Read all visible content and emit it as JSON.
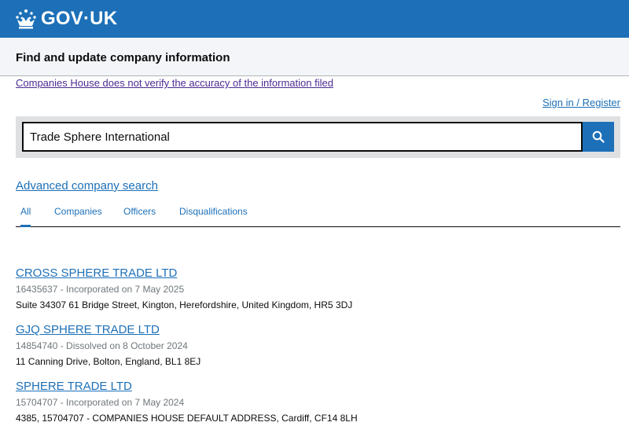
{
  "header": {
    "logo_text": "GOV",
    "logo_dot": "·",
    "logo_suffix": "UK",
    "crown_icon": "crown-icon"
  },
  "service": {
    "name": "Find and update company information"
  },
  "notice": {
    "text": "Companies House does not verify the accuracy of the information filed"
  },
  "account": {
    "signin_label": "Sign in / Register"
  },
  "search": {
    "value": "Trade Sphere International",
    "button_icon": "search-icon"
  },
  "advanced_search": {
    "label": "Advanced company search"
  },
  "tabs": [
    {
      "label": "All",
      "active": true
    },
    {
      "label": "Companies",
      "active": false
    },
    {
      "label": "Officers",
      "active": false
    },
    {
      "label": "Disqualifications",
      "active": false
    }
  ],
  "results": [
    {
      "name": "CROSS SPHERE TRADE LTD",
      "meta": "16435637 - Incorporated on 7 May 2025",
      "address": "Suite 34307 61 Bridge Street, Kington, Herefordshire, United Kingdom, HR5 3DJ"
    },
    {
      "name": "GJQ SPHERE TRADE LTD",
      "meta": "14854740 - Dissolved on 8 October 2024",
      "address": "11 Canning Drive, Bolton, England, BL1 8EJ"
    },
    {
      "name": "SPHERE TRADE LTD",
      "meta": "15704707 - Incorporated on 7 May 2024",
      "address": "4385, 15704707 - COMPANIES HOUSE DEFAULT ADDRESS, Cardiff, CF14 8LH"
    }
  ],
  "colors": {
    "brand_blue": "#1d70b8",
    "visited_purple": "#4c2c92",
    "panel_grey": "#dee0e2",
    "service_bar": "#f3f5f8"
  }
}
